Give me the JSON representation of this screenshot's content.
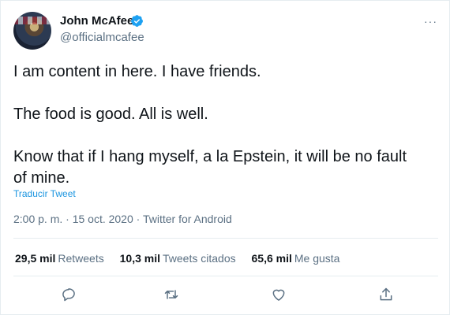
{
  "author": {
    "name": "John McAfee",
    "handle": "@officialmcafee",
    "verified": true
  },
  "tweet": {
    "lines": [
      "I am content in here. I have friends.",
      "The food is good. All is well.",
      "Know that if I hang myself, a la Epstein, it will be no fault of mine."
    ],
    "translate_label": "Traducir Tweet",
    "timestamp": "2:00 p. m. · 15 oct. 2020 · Twitter for Android"
  },
  "stats": {
    "retweets_count": "29,5 mil",
    "retweets_label": "Retweets",
    "quotes_count": "10,3 mil",
    "quotes_label": "Tweets citados",
    "likes_count": "65,6 mil",
    "likes_label": "Me gusta"
  },
  "more_label": "···",
  "colors": {
    "accent": "#1da1f2",
    "link": "#1b95e0",
    "muted": "#5b7083",
    "border": "#e6ecf0"
  },
  "icons": [
    "more-icon",
    "verified-badge-icon",
    "reply-icon",
    "retweet-icon",
    "like-icon",
    "share-icon"
  ]
}
